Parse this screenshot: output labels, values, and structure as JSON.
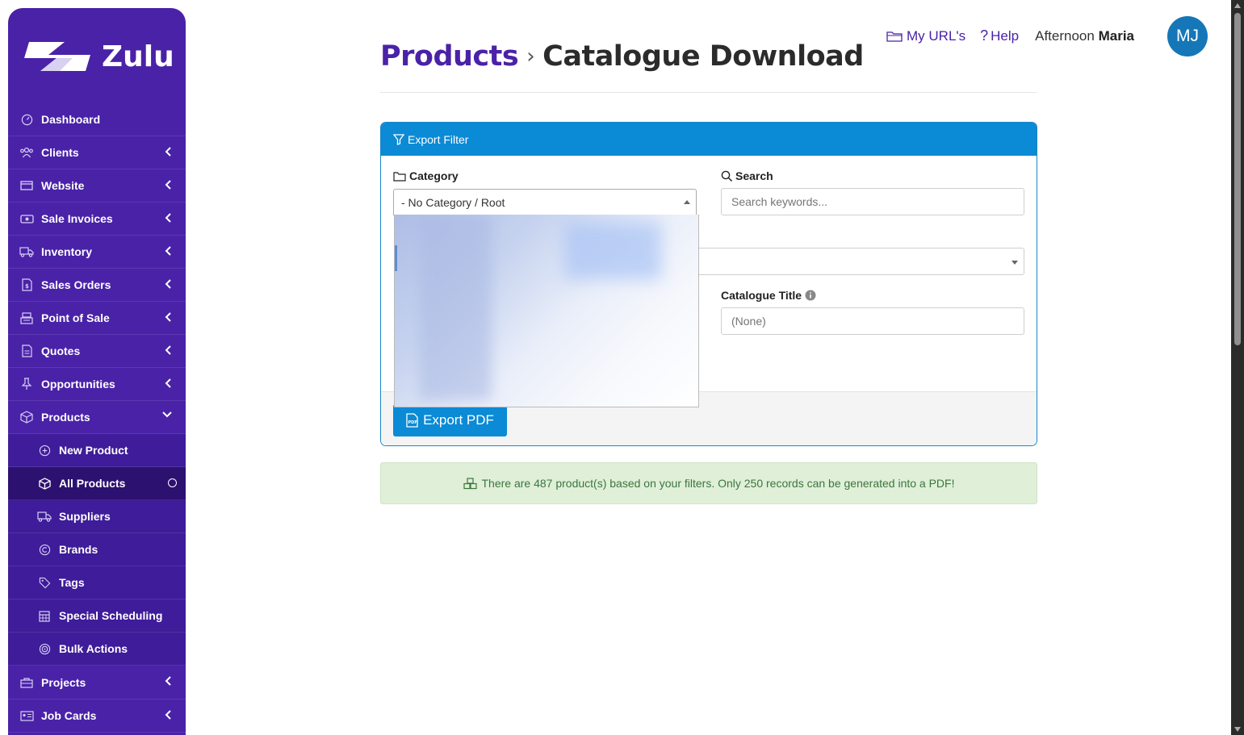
{
  "app": {
    "logo_text": "Zulu"
  },
  "sidebar": {
    "items": [
      {
        "label": "Dashboard",
        "icon": "dashboard-icon"
      },
      {
        "label": "Clients",
        "icon": "users-icon"
      },
      {
        "label": "Website",
        "icon": "browser-icon"
      },
      {
        "label": "Sale Invoices",
        "icon": "money-icon"
      },
      {
        "label": "Inventory",
        "icon": "truck-icon"
      },
      {
        "label": "Sales Orders",
        "icon": "document-icon"
      },
      {
        "label": "Point of Sale",
        "icon": "register-icon"
      },
      {
        "label": "Quotes",
        "icon": "quote-icon"
      },
      {
        "label": "Opportunities",
        "icon": "pin-icon"
      },
      {
        "label": "Products",
        "icon": "box-icon"
      }
    ],
    "products_sub": [
      {
        "label": "New Product",
        "icon": "plus-circle-icon"
      },
      {
        "label": "All Products",
        "icon": "box-icon"
      },
      {
        "label": "Suppliers",
        "icon": "truck-icon"
      },
      {
        "label": "Brands",
        "icon": "copyright-icon"
      },
      {
        "label": "Tags",
        "icon": "tag-icon"
      },
      {
        "label": "Special Scheduling",
        "icon": "calendar-icon"
      },
      {
        "label": "Bulk Actions",
        "icon": "target-icon"
      }
    ],
    "bottom_items": [
      {
        "label": "Projects",
        "icon": "briefcase-icon"
      },
      {
        "label": "Job Cards",
        "icon": "id-card-icon"
      }
    ]
  },
  "topbar": {
    "my_urls": "My URL's",
    "help": "Help",
    "greeting": "Afternoon",
    "user_name": "Maria",
    "avatar_initials": "MJ"
  },
  "header": {
    "breadcrumb_parent": "Products",
    "title": "Catalogue Download"
  },
  "filter": {
    "panel_title": "Export Filter",
    "category_label": "Category",
    "category_value": "- No Category / Root",
    "search_label": "Search",
    "search_placeholder": "Search keywords...",
    "catalogue_title_label": "Catalogue Title",
    "catalogue_title_placeholder": "(None)",
    "export_button": "Export PDF"
  },
  "alert": {
    "message": "There are 487 product(s) based on your filters. Only 250 records can be generated into a PDF!"
  },
  "colors": {
    "brand_purple": "#4a22a8",
    "primary_blue": "#0b8ad5",
    "success_bg": "#dfefd8",
    "success_text": "#3c763d"
  }
}
